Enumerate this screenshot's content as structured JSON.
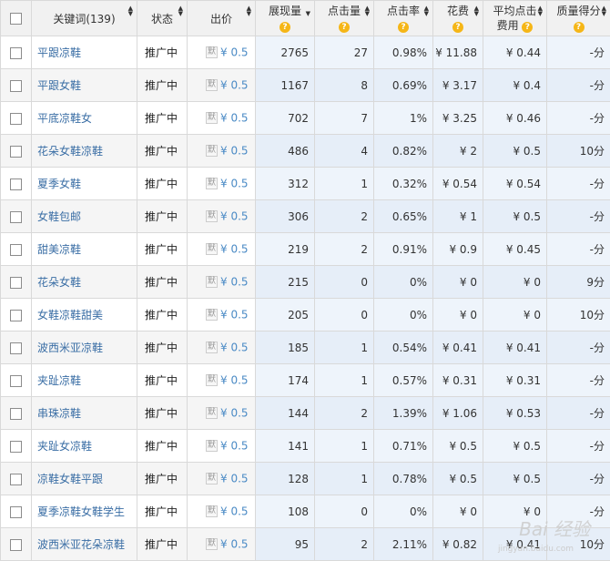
{
  "header": {
    "keyword": "关键词(139)",
    "status": "状态",
    "bid": "出价",
    "impressions": "展现量",
    "clicks": "点击量",
    "ctr": "点击率",
    "cost": "花费",
    "avg_cpc_line1": "平均点击",
    "avg_cpc_line2": "费用",
    "quality": "质量得分",
    "help_glyph": "?"
  },
  "default_tag": "默",
  "rows": [
    {
      "keyword": "平跟凉鞋",
      "status": "推广中",
      "bid": "¥ 0.5",
      "impressions": "2765",
      "clicks": "27",
      "ctr": "0.98%",
      "cost": "¥ 11.88",
      "avg_cpc": "¥ 0.44",
      "quality": "-分"
    },
    {
      "keyword": "平跟女鞋",
      "status": "推广中",
      "bid": "¥ 0.5",
      "impressions": "1167",
      "clicks": "8",
      "ctr": "0.69%",
      "cost": "¥ 3.17",
      "avg_cpc": "¥ 0.4",
      "quality": "-分"
    },
    {
      "keyword": "平底凉鞋女",
      "status": "推广中",
      "bid": "¥ 0.5",
      "impressions": "702",
      "clicks": "7",
      "ctr": "1%",
      "cost": "¥ 3.25",
      "avg_cpc": "¥ 0.46",
      "quality": "-分"
    },
    {
      "keyword": "花朵女鞋凉鞋",
      "status": "推广中",
      "bid": "¥ 0.5",
      "impressions": "486",
      "clicks": "4",
      "ctr": "0.82%",
      "cost": "¥ 2",
      "avg_cpc": "¥ 0.5",
      "quality": "10分"
    },
    {
      "keyword": "夏季女鞋",
      "status": "推广中",
      "bid": "¥ 0.5",
      "impressions": "312",
      "clicks": "1",
      "ctr": "0.32%",
      "cost": "¥ 0.54",
      "avg_cpc": "¥ 0.54",
      "quality": "-分"
    },
    {
      "keyword": "女鞋包邮",
      "status": "推广中",
      "bid": "¥ 0.5",
      "impressions": "306",
      "clicks": "2",
      "ctr": "0.65%",
      "cost": "¥ 1",
      "avg_cpc": "¥ 0.5",
      "quality": "-分"
    },
    {
      "keyword": "甜美凉鞋",
      "status": "推广中",
      "bid": "¥ 0.5",
      "impressions": "219",
      "clicks": "2",
      "ctr": "0.91%",
      "cost": "¥ 0.9",
      "avg_cpc": "¥ 0.45",
      "quality": "-分"
    },
    {
      "keyword": "花朵女鞋",
      "status": "推广中",
      "bid": "¥ 0.5",
      "impressions": "215",
      "clicks": "0",
      "ctr": "0%",
      "cost": "¥ 0",
      "avg_cpc": "¥ 0",
      "quality": "9分"
    },
    {
      "keyword": "女鞋凉鞋甜美",
      "status": "推广中",
      "bid": "¥ 0.5",
      "impressions": "205",
      "clicks": "0",
      "ctr": "0%",
      "cost": "¥ 0",
      "avg_cpc": "¥ 0",
      "quality": "10分"
    },
    {
      "keyword": "波西米亚凉鞋",
      "status": "推广中",
      "bid": "¥ 0.5",
      "impressions": "185",
      "clicks": "1",
      "ctr": "0.54%",
      "cost": "¥ 0.41",
      "avg_cpc": "¥ 0.41",
      "quality": "-分"
    },
    {
      "keyword": "夹趾凉鞋",
      "status": "推广中",
      "bid": "¥ 0.5",
      "impressions": "174",
      "clicks": "1",
      "ctr": "0.57%",
      "cost": "¥ 0.31",
      "avg_cpc": "¥ 0.31",
      "quality": "-分"
    },
    {
      "keyword": "串珠凉鞋",
      "status": "推广中",
      "bid": "¥ 0.5",
      "impressions": "144",
      "clicks": "2",
      "ctr": "1.39%",
      "cost": "¥ 1.06",
      "avg_cpc": "¥ 0.53",
      "quality": "-分"
    },
    {
      "keyword": "夹趾女凉鞋",
      "status": "推广中",
      "bid": "¥ 0.5",
      "impressions": "141",
      "clicks": "1",
      "ctr": "0.71%",
      "cost": "¥ 0.5",
      "avg_cpc": "¥ 0.5",
      "quality": "-分"
    },
    {
      "keyword": "凉鞋女鞋平跟",
      "status": "推广中",
      "bid": "¥ 0.5",
      "impressions": "128",
      "clicks": "1",
      "ctr": "0.78%",
      "cost": "¥ 0.5",
      "avg_cpc": "¥ 0.5",
      "quality": "-分"
    },
    {
      "keyword": "夏季凉鞋女鞋学生",
      "status": "推广中",
      "bid": "¥ 0.5",
      "impressions": "108",
      "clicks": "0",
      "ctr": "0%",
      "cost": "¥ 0",
      "avg_cpc": "¥ 0",
      "quality": "-分"
    },
    {
      "keyword": "波西米亚花朵凉鞋",
      "status": "推广中",
      "bid": "¥ 0.5",
      "impressions": "95",
      "clicks": "2",
      "ctr": "2.11%",
      "cost": "¥ 0.82",
      "avg_cpc": "¥ 0.41",
      "quality": "10分"
    }
  ],
  "watermark": {
    "text": "Bai 经验",
    "sub": "jingyan.baidu.com"
  }
}
